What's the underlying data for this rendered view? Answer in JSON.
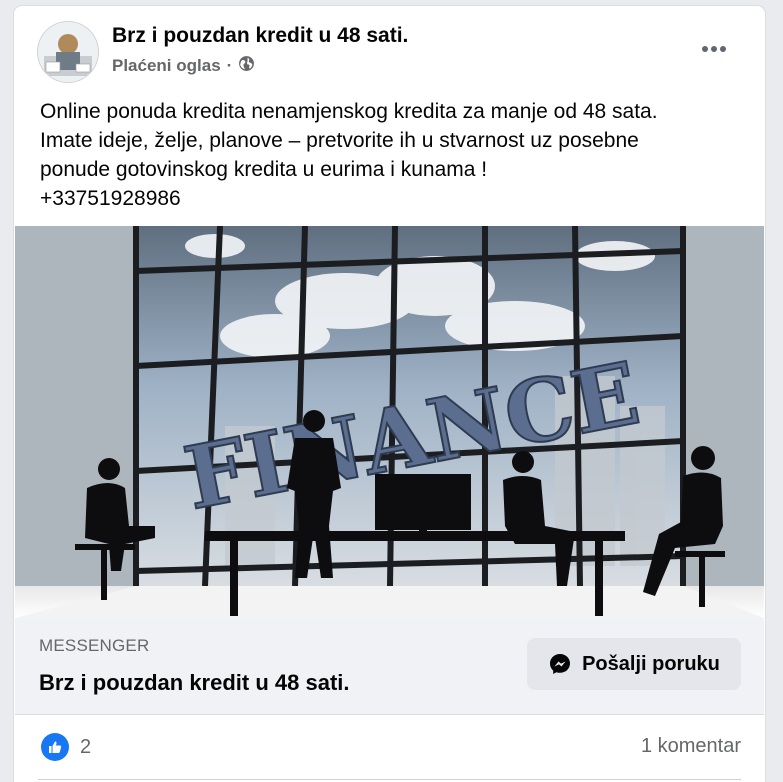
{
  "post": {
    "page_name": "Brz i pouzdan kredit u 48 sati.",
    "sponsored_label": "Plaćeni oglas",
    "separator": "·",
    "more_icon": "more-horizontal-icon",
    "privacy_icon": "globe-icon",
    "text_lines": [
      "Online ponuda kredita nenamjenskog kredita za manje od 48 sata.",
      "Imate ideje, želje, planove – pretvorite ih u stvarnost uz posebne",
      "ponude  gotovinskog kredita u eurima i kunama !",
      "+33751928986"
    ]
  },
  "media": {
    "image_text": "FINANCE"
  },
  "cta": {
    "source": "MESSENGER",
    "headline": "Brz i pouzdan kredit u 48 sati.",
    "button_label": "Pošalji poruku",
    "button_icon": "messenger-icon"
  },
  "engagement": {
    "like_icon": "thumbs-up-icon",
    "like_count": "2",
    "comment_count": "1 komentar"
  },
  "colors": {
    "accent": "#1877f2",
    "secondary_text": "#65676b",
    "cta_background": "#f0f2f5"
  }
}
